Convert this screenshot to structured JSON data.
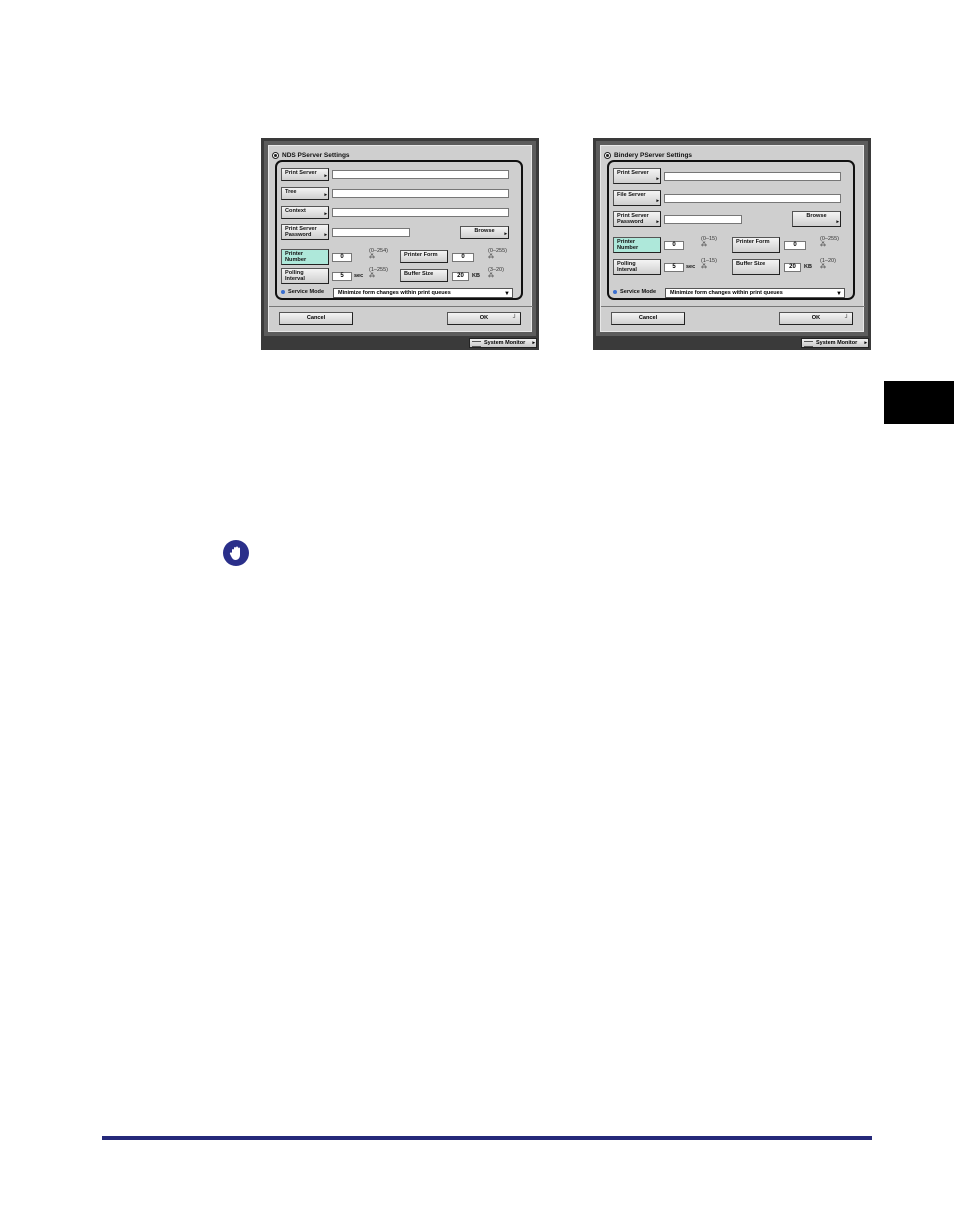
{
  "nds_panel": {
    "title": "NDS PServer Settings",
    "print_server_label": "Print Server",
    "tree_label": "Tree",
    "context_label": "Context",
    "print_server_password_label": "Print Server Password",
    "browse_label": "Browse",
    "printer_number_label": "Printer Number",
    "printer_number_value": "0",
    "printer_number_range": "(0–254)",
    "printer_form_label": "Printer Form",
    "printer_form_value": "0",
    "printer_form_range": "(0–255)",
    "polling_interval_label": "Polling Interval",
    "polling_interval_value": "5",
    "polling_interval_unit": "sec",
    "polling_interval_range": "(1–255)",
    "buffer_size_label": "Buffer Size",
    "buffer_size_value": "20",
    "buffer_size_unit": "KB",
    "buffer_size_range": "(3–20)",
    "service_mode_label": "Service Mode",
    "service_mode_value": "Minimize form changes within print queues",
    "cancel_label": "Cancel",
    "ok_label": "OK",
    "system_monitor_label": "System Monitor"
  },
  "bindery_panel": {
    "title": "Bindery PServer Settings",
    "print_server_label": "Print Server",
    "file_server_label": "File Server",
    "print_server_password_label": "Print Server Password",
    "browse_label": "Browse",
    "printer_number_label": "Printer Number",
    "printer_number_value": "0",
    "printer_number_range": "(0–15)",
    "printer_form_label": "Printer Form",
    "printer_form_value": "0",
    "printer_form_range": "(0–255)",
    "polling_interval_label": "Polling Interval",
    "polling_interval_value": "5",
    "polling_interval_unit": "sec",
    "polling_interval_range": "(1–15)",
    "buffer_size_label": "Buffer Size",
    "buffer_size_value": "20",
    "buffer_size_unit": "KB",
    "buffer_size_range": "(1–20)",
    "service_mode_label": "Service Mode",
    "service_mode_value": "Minimize form changes within print queues",
    "cancel_label": "Cancel",
    "ok_label": "OK",
    "system_monitor_label": "System Monitor"
  },
  "icons": {
    "important": "hand-stop-icon"
  },
  "colors": {
    "footer_rule": "#25297a",
    "active_button": "#aee8da",
    "side_tab": "#000000"
  }
}
